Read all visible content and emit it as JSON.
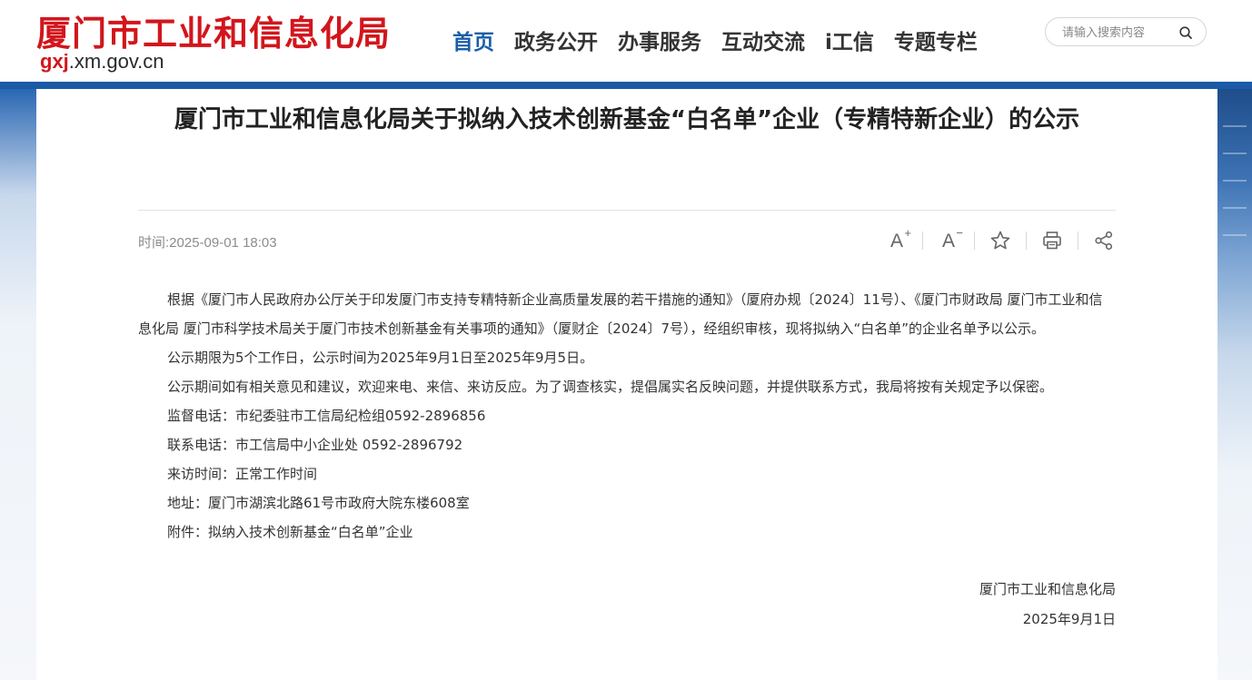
{
  "header": {
    "site_title": "厦门市工业和信息化局",
    "domain_prefix": "gxj",
    "domain_rest": ".xm.gov.cn",
    "nav": [
      {
        "label": "首页",
        "active": true
      },
      {
        "label": "政务公开",
        "active": false
      },
      {
        "label": "办事服务",
        "active": false
      },
      {
        "label": "互动交流",
        "active": false
      },
      {
        "label": "i工信",
        "active": false
      },
      {
        "label": "专题专栏",
        "active": false
      }
    ],
    "search_placeholder": "请输入搜索内容"
  },
  "article": {
    "title": "厦门市工业和信息化局关于拟纳入技术创新基金“白名单”企业（专精特新企业）的公示",
    "time_label": "时间:",
    "time_value": "2025-09-01 18:03",
    "tools": [
      "font-increase-icon",
      "font-decrease-icon",
      "star-icon",
      "print-icon",
      "share-icon"
    ],
    "paragraphs": [
      "根据《厦门市人民政府办公厅关于印发厦门市支持专精特新企业高质量发展的若干措施的通知》（厦府办规〔2024〕11号）、《厦门市财政局 厦门市工业和信息化局 厦门市科学技术局关于厦门市技术创新基金有关事项的通知》（厦财企〔2024〕7号），经组织审核，现将拟纳入“白名单”的企业名单予以公示。",
      "公示期限为5个工作日，公示时间为2025年9月1日至2025年9月5日。",
      "公示期间如有相关意见和建议，欢迎来电、来信、来访反应。为了调查核实，提倡属实名反映问题，并提供联系方式，我局将按有关规定予以保密。",
      "监督电话：市纪委驻市工信局纪检组0592-2896856",
      "联系电话：市工信局中小企业处 0592-2896792",
      "来访时间：正常工作时间",
      "地址：厦门市湖滨北路61号市政府大院东楼608室"
    ],
    "attachment_label": "附件：",
    "attachment_link": "拟纳入技术创新基金“白名单”企业",
    "signature": "厦门市工业和信息化局",
    "date": "2025年9月1日"
  },
  "colors": {
    "brand_red": "#d2161c",
    "nav_active": "#1a5ea8",
    "band_blue": "#1b5aa6"
  }
}
